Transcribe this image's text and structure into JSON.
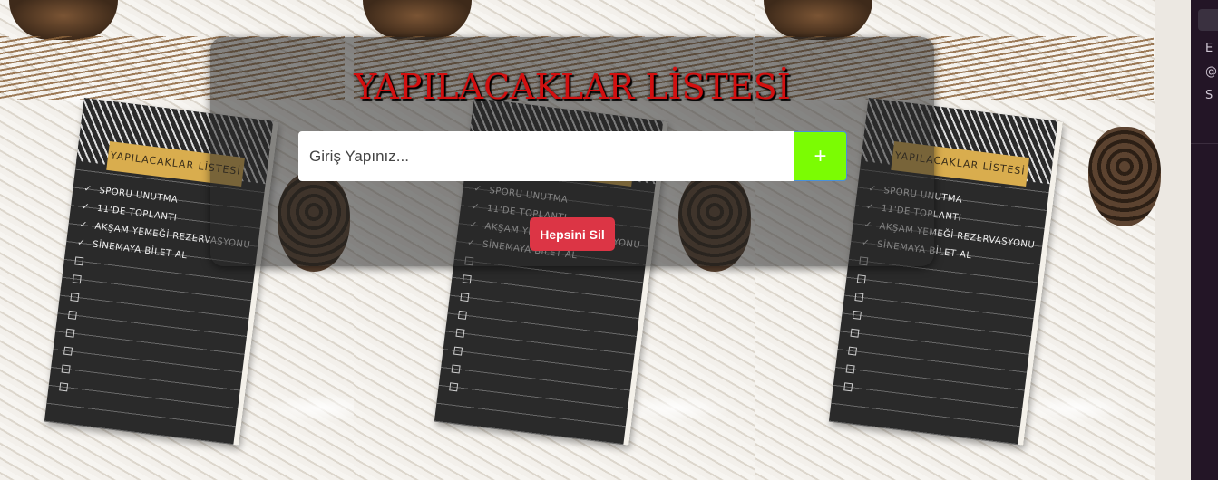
{
  "app": {
    "title": "YAPILACAKLAR LİSTESİ"
  },
  "form": {
    "input_placeholder": "Giriş Yapınız...",
    "input_value": "",
    "add_label": "+",
    "clear_all_label": "Hepsini Sil"
  },
  "background": {
    "notebook_title": "YAPILACAKLAR LİSTESİ",
    "notebook_items": [
      "SPORU UNUTMA",
      "11'DE TOPLANTI",
      "AKŞAM YEMEĞİ REZERVASYONU",
      "SİNEMAYA BİLET AL"
    ]
  },
  "side_panel": {
    "chars": [
      "E",
      "@",
      "S"
    ]
  },
  "colors": {
    "title_red": "#d11010",
    "add_button_green": "#7bfc03",
    "clear_button_red": "#dc3545",
    "panel_overlay": "rgba(40,40,40,.55)"
  }
}
